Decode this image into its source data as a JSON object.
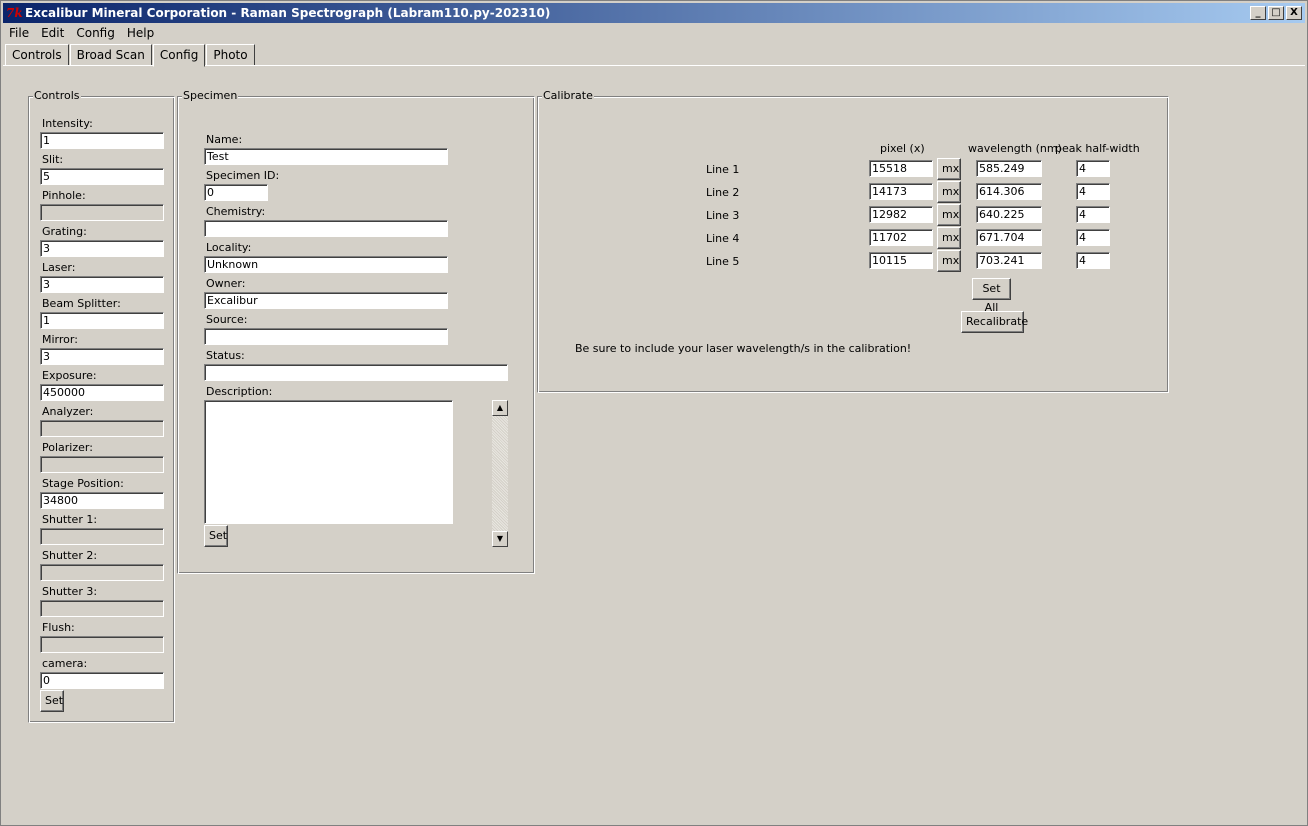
{
  "window": {
    "title": "Excalibur Mineral Corporation - Raman Spectrograph (Labram110.py-202310)",
    "minimize": "_",
    "maximize": "□",
    "close": "X"
  },
  "menu": [
    "File",
    "Edit",
    "Config",
    "Help"
  ],
  "tabs": [
    "Controls",
    "Broad Scan",
    "Config",
    "Photo"
  ],
  "controls": {
    "title": "Controls",
    "fields": [
      {
        "label": "Intensity:",
        "value": "1"
      },
      {
        "label": "Slit:",
        "value": "5"
      },
      {
        "label": "Pinhole:",
        "value": ""
      },
      {
        "label": "Grating:",
        "value": "3"
      },
      {
        "label": "Laser:",
        "value": "3"
      },
      {
        "label": "Beam Splitter:",
        "value": "1"
      },
      {
        "label": "Mirror:",
        "value": "3"
      },
      {
        "label": "Exposure:",
        "value": "450000"
      },
      {
        "label": "Analyzer:",
        "value": ""
      },
      {
        "label": "Polarizer:",
        "value": ""
      },
      {
        "label": "Stage Position:",
        "value": "34800"
      },
      {
        "label": "Shutter 1:",
        "value": ""
      },
      {
        "label": "Shutter 2:",
        "value": ""
      },
      {
        "label": "Shutter 3:",
        "value": ""
      },
      {
        "label": "Flush:",
        "value": ""
      },
      {
        "label": "camera:",
        "value": "0"
      }
    ],
    "set_label": "Set"
  },
  "specimen": {
    "title": "Specimen",
    "name_label": "Name:",
    "name_value": "Test",
    "id_label": "Specimen ID:",
    "id_value": "0",
    "chemistry_label": "Chemistry:",
    "chemistry_value": "",
    "locality_label": "Locality:",
    "locality_value": "Unknown",
    "owner_label": "Owner:",
    "owner_value": "Excalibur",
    "source_label": "Source:",
    "source_value": "",
    "status_label": "Status:",
    "status_value": "",
    "description_label": "Description:",
    "description_value": "",
    "set_label": "Set"
  },
  "calibrate": {
    "title": "Calibrate",
    "col_pixel": "pixel (x)",
    "col_wavelength": "wavelength (nm)",
    "col_halfwidth": "peak half-width",
    "mx_label": "mx",
    "lines": [
      {
        "label": "Line 1",
        "pixel": "15518",
        "wavelength": "585.249",
        "halfwidth": "4"
      },
      {
        "label": "Line 2",
        "pixel": "14173",
        "wavelength": "614.306",
        "halfwidth": "4"
      },
      {
        "label": "Line 3",
        "pixel": "12982",
        "wavelength": "640.225",
        "halfwidth": "4"
      },
      {
        "label": "Line 4",
        "pixel": "11702",
        "wavelength": "671.704",
        "halfwidth": "4"
      },
      {
        "label": "Line 5",
        "pixel": "10115",
        "wavelength": "703.241",
        "halfwidth": "4"
      }
    ],
    "set_all_label": "Set All",
    "recalibrate_label": "Recalibrate",
    "note": "Be sure to include your laser wavelength/s in the calibration!"
  }
}
